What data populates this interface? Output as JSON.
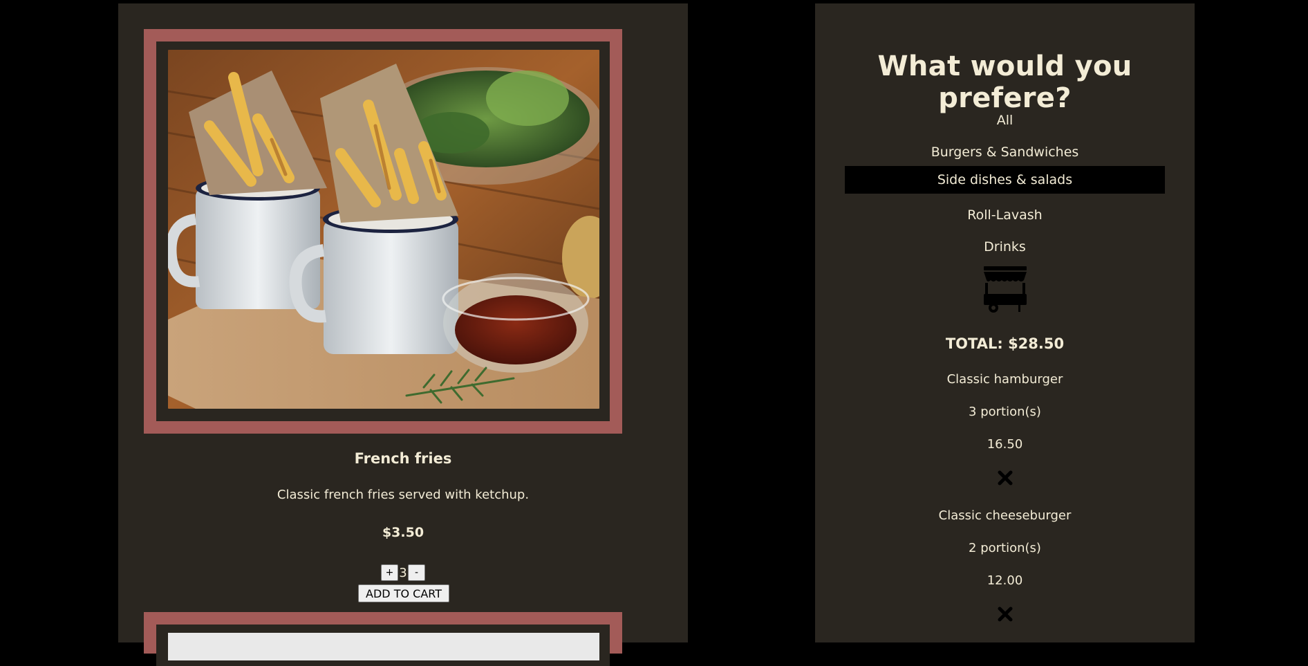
{
  "product": {
    "title": "French fries",
    "description": "Classic french fries served with ketchup.",
    "price": "$3.50",
    "quantity": "3",
    "plus_label": "+",
    "minus_label": "-",
    "add_to_cart_label": "ADD TO CART"
  },
  "sidebar": {
    "heading": "What would you prefere?",
    "categories": [
      {
        "label": "All"
      },
      {
        "label": "Burgers & Sandwiches"
      },
      {
        "label": "Side dishes & salads"
      },
      {
        "label": "Roll-Lavash"
      },
      {
        "label": "Drinks"
      }
    ],
    "active_category": "Side dishes & salads",
    "cart_icon": "food-cart-icon",
    "total": "TOTAL: $28.50",
    "cart_items": [
      {
        "name": "Classic hamburger",
        "portions": "3 portion(s)",
        "price": "16.50",
        "remove_icon": "close-icon"
      },
      {
        "name": "Classic cheeseburger",
        "portions": "2 portion(s)",
        "price": "12.00",
        "remove_icon": "close-icon"
      }
    ]
  },
  "colors": {
    "page_background": "#000000",
    "panel_background": "#2a2620",
    "frame_accent": "#a35b58",
    "text": "#f3ecd6",
    "active_category_background": "#000000"
  }
}
